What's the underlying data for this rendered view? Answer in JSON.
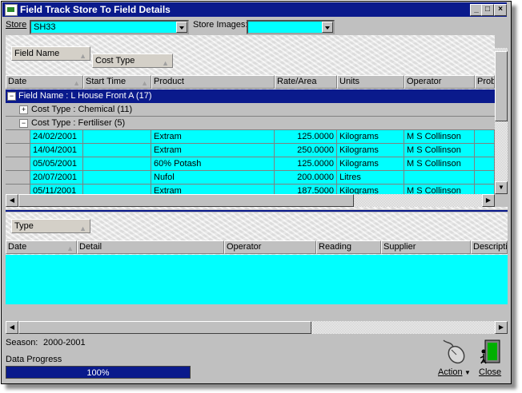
{
  "window": {
    "title": "Field Track Store To Field Details"
  },
  "title_buttons": {
    "minimize": "_",
    "maximize": "□",
    "close": "×"
  },
  "store": {
    "label": "Store",
    "value": "SH33"
  },
  "store_images": {
    "label": "Store Images:",
    "value": ""
  },
  "top_panel": {
    "group_chips": [
      "Field Name",
      "Cost Type"
    ],
    "columns": [
      "Date",
      "Start Time",
      "Product",
      "Rate/Area",
      "Units",
      "Operator",
      "Probl"
    ],
    "group_row": {
      "expander": "−",
      "label": "Field Name : L House Front A  (17)"
    },
    "subgroups": [
      {
        "expander": "+",
        "label": "Cost Type : Chemical  (11)"
      },
      {
        "expander": "−",
        "label": "Cost Type : Fertiliser  (5)"
      }
    ],
    "rows": [
      {
        "date": "24/02/2001",
        "start_time": "",
        "product": "Extram",
        "rate": "125.0000",
        "units": "Kilograms",
        "operator": "M S Collinson",
        "problem": ""
      },
      {
        "date": "14/04/2001",
        "start_time": "",
        "product": "Extram",
        "rate": "250.0000",
        "units": "Kilograms",
        "operator": "M S Collinson",
        "problem": ""
      },
      {
        "date": "05/05/2001",
        "start_time": "",
        "product": "60% Potash",
        "rate": "125.0000",
        "units": "Kilograms",
        "operator": "M S Collinson",
        "problem": ""
      },
      {
        "date": "20/07/2001",
        "start_time": "",
        "product": "Nufol",
        "rate": "200.0000",
        "units": "Litres",
        "operator": "",
        "problem": ""
      },
      {
        "date": "05/11/2001",
        "start_time": "",
        "product": "Extram",
        "rate": "187.5000",
        "units": "Kilograms",
        "operator": "M S Collinson",
        "problem": ""
      }
    ]
  },
  "bottom_panel": {
    "group_chip": "Type",
    "columns": [
      "Date",
      "Detail",
      "Operator",
      "Reading",
      "Supplier",
      "Descriptio"
    ]
  },
  "status": {
    "season_label": "Season:",
    "season_value": "2000-2001",
    "progress_label": "Data Progress",
    "progress_text": "100%",
    "progress_value": 1.0
  },
  "actions": {
    "action_label": "Action",
    "close_label": "Close"
  },
  "colors": {
    "title_bar": "#0a1a8c",
    "row_fill": "#00ffff",
    "selected_group": "#0a1a8c",
    "face": "#c0c0c0"
  },
  "icons": {
    "action": "mouse-icon",
    "close": "exit-door-icon"
  }
}
